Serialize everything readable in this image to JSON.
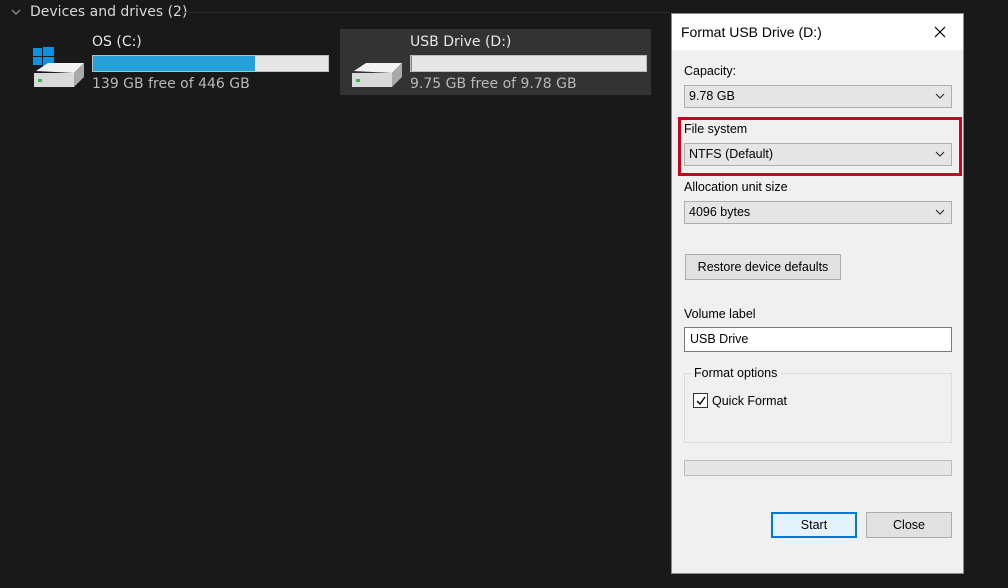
{
  "explorer": {
    "section_title": "Devices and drives (2)",
    "drives": [
      {
        "name": "OS (C:)",
        "free_text": "139 GB free of 446 GB",
        "used_fraction": 0.688,
        "icon": "windows-drive-icon"
      },
      {
        "name": "USB Drive (D:)",
        "free_text": "9.75 GB free of 9.78 GB",
        "used_fraction": 0.003,
        "icon": "usb-drive-icon"
      }
    ]
  },
  "dialog": {
    "title": "Format USB Drive (D:)",
    "capacity_label": "Capacity:",
    "capacity_value": "9.78 GB",
    "filesystem_label": "File system",
    "filesystem_value": "NTFS (Default)",
    "allocation_label": "Allocation unit size",
    "allocation_value": "4096 bytes",
    "restore_button": "Restore device defaults",
    "volume_label_label": "Volume label",
    "volume_label_value": "USB Drive",
    "format_options_label": "Format options",
    "quick_format_label": "Quick Format",
    "quick_format_checked": true,
    "progress_fraction": 0,
    "start_button": "Start",
    "close_button": "Close"
  },
  "colors": {
    "accent_bar": "#26a0da",
    "highlight_box": "#d0021b",
    "default_button_border": "#0078d7"
  }
}
